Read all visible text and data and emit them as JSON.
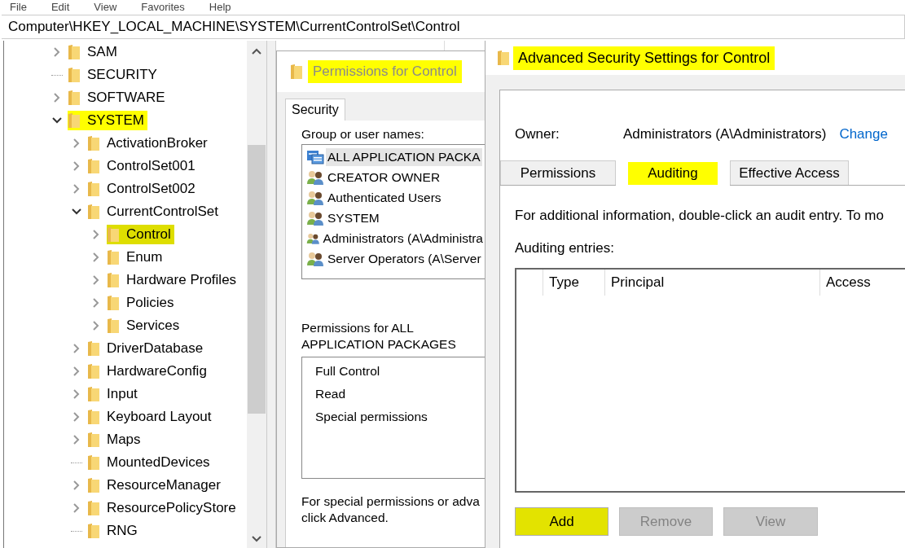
{
  "menu": [
    "File",
    "Edit",
    "View",
    "Favorites",
    "Help"
  ],
  "address": "Computer\\HKEY_LOCAL_MACHINE\\SYSTEM\\CurrentControlSet\\Control",
  "tree": [
    {
      "label": "SAM",
      "expandable": true,
      "expanded": false,
      "highlighted": false,
      "selected": false
    },
    {
      "label": "SECURITY",
      "expandable": false,
      "expanded": false,
      "highlighted": false,
      "selected": false
    },
    {
      "label": "SOFTWARE",
      "expandable": true,
      "expanded": false,
      "highlighted": false,
      "selected": false
    },
    {
      "label": "SYSTEM",
      "expandable": true,
      "expanded": true,
      "highlighted": true,
      "selected": false,
      "children": [
        {
          "label": "ActivationBroker",
          "expandable": true,
          "expanded": false,
          "highlighted": false,
          "selected": false
        },
        {
          "label": "ControlSet001",
          "expandable": true,
          "expanded": false,
          "highlighted": false,
          "selected": false
        },
        {
          "label": "ControlSet002",
          "expandable": true,
          "expanded": false,
          "highlighted": false,
          "selected": false
        },
        {
          "label": "CurrentControlSet",
          "expandable": true,
          "expanded": true,
          "highlighted": false,
          "selected": false,
          "children": [
            {
              "label": "Control",
              "expandable": true,
              "expanded": false,
              "highlighted": true,
              "selected": true
            },
            {
              "label": "Enum",
              "expandable": true,
              "expanded": false,
              "highlighted": false,
              "selected": false
            },
            {
              "label": "Hardware Profiles",
              "expandable": true,
              "expanded": false,
              "highlighted": false,
              "selected": false
            },
            {
              "label": "Policies",
              "expandable": true,
              "expanded": false,
              "highlighted": false,
              "selected": false
            },
            {
              "label": "Services",
              "expandable": true,
              "expanded": false,
              "highlighted": false,
              "selected": false
            }
          ]
        },
        {
          "label": "DriverDatabase",
          "expandable": true,
          "expanded": false,
          "highlighted": false,
          "selected": false
        },
        {
          "label": "HardwareConfig",
          "expandable": true,
          "expanded": false,
          "highlighted": false,
          "selected": false
        },
        {
          "label": "Input",
          "expandable": true,
          "expanded": false,
          "highlighted": false,
          "selected": false
        },
        {
          "label": "Keyboard Layout",
          "expandable": true,
          "expanded": false,
          "highlighted": false,
          "selected": false
        },
        {
          "label": "Maps",
          "expandable": true,
          "expanded": false,
          "highlighted": false,
          "selected": false
        },
        {
          "label": "MountedDevices",
          "expandable": false,
          "expanded": false,
          "highlighted": false,
          "selected": false
        },
        {
          "label": "ResourceManager",
          "expandable": true,
          "expanded": false,
          "highlighted": false,
          "selected": false
        },
        {
          "label": "ResourcePolicyStore",
          "expandable": true,
          "expanded": false,
          "highlighted": false,
          "selected": false
        },
        {
          "label": "RNG",
          "expandable": false,
          "expanded": false,
          "highlighted": false,
          "selected": false
        }
      ]
    }
  ],
  "permissions_dialog": {
    "title": "Permissions for Control",
    "title_highlighted": true,
    "active": false,
    "tabs": [
      {
        "label": "Security",
        "selected": true
      }
    ],
    "group_label": "Group or user names:",
    "users": [
      {
        "name": "ALL APPLICATION PACKA",
        "kind": "package",
        "selected": true
      },
      {
        "name": "CREATOR OWNER",
        "kind": "group",
        "selected": false
      },
      {
        "name": "Authenticated Users",
        "kind": "group",
        "selected": false
      },
      {
        "name": "SYSTEM",
        "kind": "group",
        "selected": false
      },
      {
        "name": "Administrators (A\\Administra",
        "kind": "group",
        "selected": false
      },
      {
        "name": "Server Operators (A\\Server",
        "kind": "group",
        "selected": false
      }
    ],
    "permissions_label": "Permissions for ALL APPLICATION PACKAGES",
    "permissions": [
      "Full Control",
      "Read",
      "Special permissions"
    ],
    "footer": "For special permissions or adva click Advanced."
  },
  "advanced_dialog": {
    "title": "Advanced Security Settings for Control",
    "title_highlighted": true,
    "owner_label": "Owner:",
    "owner": "Administrators (A\\Administrators)",
    "change_link": "Change",
    "tabs": [
      {
        "label": "Permissions",
        "selected": false,
        "highlighted": false
      },
      {
        "label": "Auditing",
        "selected": true,
        "highlighted": true
      },
      {
        "label": "Effective Access",
        "selected": false,
        "highlighted": false
      }
    ],
    "info": "For additional information, double-click an audit entry. To mo",
    "entries_label": "Auditing entries:",
    "columns": [
      "Type",
      "Principal",
      "Access"
    ],
    "buttons": [
      {
        "label": "Add",
        "disabled": false,
        "highlighted": true
      },
      {
        "label": "Remove",
        "disabled": true,
        "highlighted": false
      },
      {
        "label": "View",
        "disabled": true,
        "highlighted": false
      }
    ]
  }
}
